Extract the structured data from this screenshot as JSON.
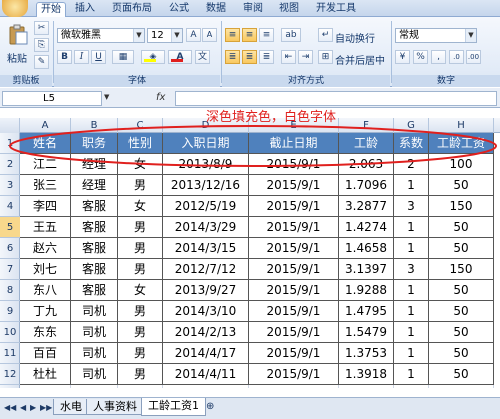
{
  "ribbon": {
    "tabs": [
      "开始",
      "插入",
      "页面布局",
      "公式",
      "数据",
      "审阅",
      "视图",
      "开发工具"
    ],
    "active_tab": "开始",
    "clipboard": {
      "paste_label": "粘贴",
      "group_label": "剪贴板"
    },
    "font": {
      "name": "微软雅黑",
      "size": "12",
      "group_label": "字体",
      "bold": "B",
      "italic": "I",
      "underline": "U",
      "font_color": "#e0201e",
      "fill_color": "#ffff00"
    },
    "alignment": {
      "wrap_label": "自动换行",
      "merge_label": "合并后居中",
      "group_label": "对齐方式"
    },
    "number": {
      "format": "常规",
      "percent": "%",
      "comma": ",",
      "group_label": "数字"
    }
  },
  "formula_bar": {
    "cell_ref": "L5",
    "fx": "fx",
    "content": ""
  },
  "annotation": "深色填充色，白色字体",
  "grid": {
    "columns": [
      "A",
      "B",
      "C",
      "D",
      "E",
      "F",
      "G",
      "H"
    ],
    "rows": [
      "1",
      "2",
      "3",
      "4",
      "5",
      "6",
      "7",
      "8",
      "9",
      "10",
      "11",
      "12"
    ],
    "selected_row": "5",
    "header_fill": "#4f81bd",
    "header_text_color": "#ffffff",
    "table_header": [
      "姓名",
      "职务",
      "性别",
      "入职日期",
      "截止日期",
      "工龄",
      "系数",
      "工龄工资"
    ],
    "table_rows": [
      [
        "江二",
        "经理",
        "女",
        "2013/8/9",
        "2015/9/1",
        "2.063",
        "2",
        "100"
      ],
      [
        "张三",
        "经理",
        "男",
        "2013/12/16",
        "2015/9/1",
        "1.7096",
        "1",
        "50"
      ],
      [
        "李四",
        "客服",
        "女",
        "2012/5/19",
        "2015/9/1",
        "3.2877",
        "3",
        "150"
      ],
      [
        "王五",
        "客服",
        "男",
        "2014/3/29",
        "2015/9/1",
        "1.4274",
        "1",
        "50"
      ],
      [
        "赵六",
        "客服",
        "男",
        "2014/3/15",
        "2015/9/1",
        "1.4658",
        "1",
        "50"
      ],
      [
        "刘七",
        "客服",
        "男",
        "2012/7/12",
        "2015/9/1",
        "3.1397",
        "3",
        "150"
      ],
      [
        "东八",
        "客服",
        "女",
        "2013/9/27",
        "2015/9/1",
        "1.9288",
        "1",
        "50"
      ],
      [
        "丁九",
        "司机",
        "男",
        "2014/3/10",
        "2015/9/1",
        "1.4795",
        "1",
        "50"
      ],
      [
        "东东",
        "司机",
        "男",
        "2014/2/13",
        "2015/9/1",
        "1.5479",
        "1",
        "50"
      ],
      [
        "百百",
        "司机",
        "男",
        "2014/4/17",
        "2015/9/1",
        "1.3753",
        "1",
        "50"
      ],
      [
        "杜杜",
        "司机",
        "男",
        "2014/4/11",
        "2015/9/1",
        "1.3918",
        "1",
        "50"
      ]
    ]
  },
  "sheet_tabs": [
    "水电",
    "人事资料",
    "工龄工资1"
  ],
  "active_sheet": "工龄工资1"
}
